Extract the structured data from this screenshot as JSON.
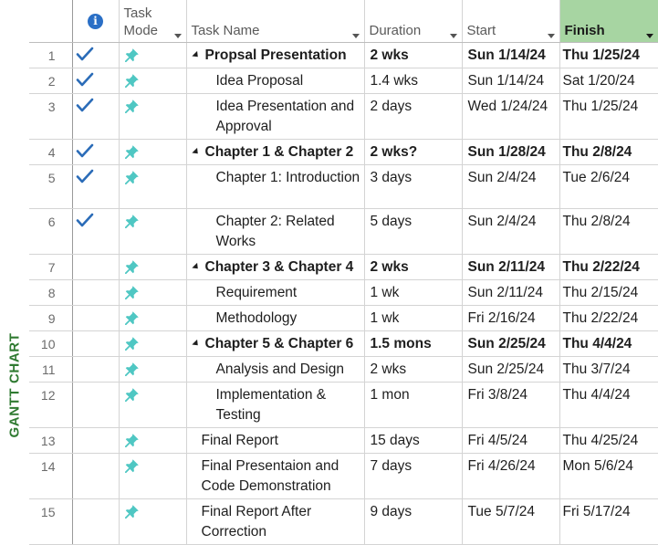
{
  "side_label": "GANTT CHART",
  "columns": {
    "task_mode": "Task Mode",
    "task_name": "Task Name",
    "duration": "Duration",
    "start": "Start",
    "finish": "Finish",
    "info_glyph": "i"
  },
  "rows": [
    {
      "id": "1",
      "done": true,
      "summary": true,
      "level": 0,
      "name": "Propsal Presentation",
      "duration": "2 wks",
      "start": "Sun 1/14/24",
      "finish": "Thu 1/25/24"
    },
    {
      "id": "2",
      "done": true,
      "summary": false,
      "level": 2,
      "name": "Idea Proposal",
      "duration": "1.4 wks",
      "start": "Sun 1/14/24",
      "finish": "Sat 1/20/24"
    },
    {
      "id": "3",
      "done": true,
      "summary": false,
      "level": 2,
      "name": "Idea Presentation and Approval",
      "duration": "2 days",
      "start": "Wed 1/24/24",
      "finish": "Thu 1/25/24"
    },
    {
      "id": "4",
      "done": true,
      "summary": true,
      "level": 0,
      "name": "Chapter 1 & Chapter 2",
      "duration": "2 wks?",
      "start": "Sun 1/28/24",
      "finish": "Thu 2/8/24"
    },
    {
      "id": "5",
      "done": true,
      "summary": false,
      "level": 2,
      "name": "Chapter 1: Introduction",
      "duration": "3 days",
      "start": "Sun 2/4/24",
      "finish": "Tue 2/6/24"
    },
    {
      "id": "6",
      "done": true,
      "summary": false,
      "level": 2,
      "name": "Chapter 2: Related Works",
      "duration": "5 days",
      "start": "Sun 2/4/24",
      "finish": "Thu 2/8/24"
    },
    {
      "id": "7",
      "done": false,
      "summary": true,
      "level": 0,
      "name": "Chapter 3 & Chapter 4",
      "duration": "2 wks",
      "start": "Sun 2/11/24",
      "finish": "Thu 2/22/24"
    },
    {
      "id": "8",
      "done": false,
      "summary": false,
      "level": 2,
      "name": "Requirement",
      "duration": "1 wk",
      "start": "Sun 2/11/24",
      "finish": "Thu 2/15/24"
    },
    {
      "id": "9",
      "done": false,
      "summary": false,
      "level": 2,
      "name": "Methodology",
      "duration": "1 wk",
      "start": "Fri 2/16/24",
      "finish": "Thu 2/22/24"
    },
    {
      "id": "10",
      "done": false,
      "summary": true,
      "level": 0,
      "name": "Chapter 5 & Chapter 6",
      "duration": "1.5 mons",
      "start": "Sun 2/25/24",
      "finish": "Thu 4/4/24"
    },
    {
      "id": "11",
      "done": false,
      "summary": false,
      "level": 2,
      "name": "Analysis and Design",
      "duration": "2 wks",
      "start": "Sun 2/25/24",
      "finish": "Thu 3/7/24"
    },
    {
      "id": "12",
      "done": false,
      "summary": false,
      "level": 2,
      "name": "Implementation & Testing",
      "duration": "1 mon",
      "start": "Fri 3/8/24",
      "finish": "Thu 4/4/24"
    },
    {
      "id": "13",
      "done": false,
      "summary": false,
      "level": 1,
      "name": "Final Report",
      "duration": "15 days",
      "start": "Fri 4/5/24",
      "finish": "Thu 4/25/24"
    },
    {
      "id": "14",
      "done": false,
      "summary": false,
      "level": 1,
      "name": "Final Presentaion and Code Demonstration",
      "duration": "7 days",
      "start": "Fri 4/26/24",
      "finish": "Mon 5/6/24"
    },
    {
      "id": "15",
      "done": false,
      "summary": false,
      "level": 1,
      "name": "Final Report After Correction",
      "duration": "9 days",
      "start": "Tue 5/7/24",
      "finish": "Fri 5/17/24"
    }
  ],
  "colors": {
    "check": "#2b6cb8",
    "pin": "#4fc7c3",
    "finish_header_bg": "#a7d5a2",
    "side_label": "#2f7a31"
  },
  "icons": {
    "info": "info-icon",
    "done": "check-icon",
    "mode": "pushpin-icon",
    "collapse": "collapse-triangle-icon",
    "dropdown": "dropdown-arrow-icon"
  }
}
